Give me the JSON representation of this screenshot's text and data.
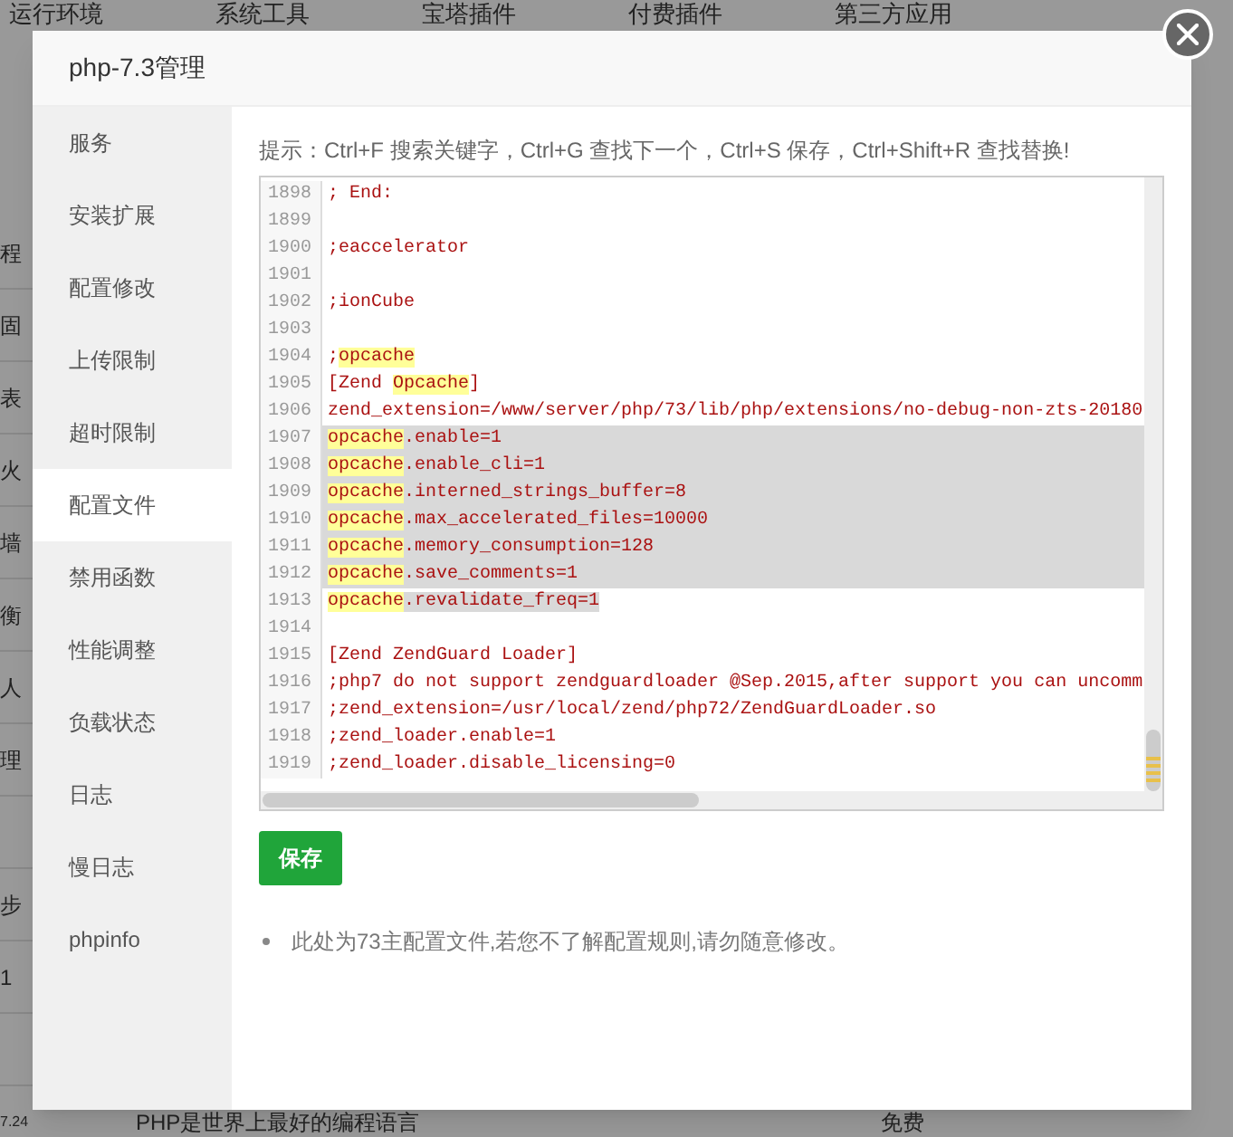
{
  "background": {
    "nav_tabs": [
      "运行环境",
      "系统工具",
      "宝塔插件",
      "付费插件",
      "第三方应用"
    ],
    "side_fragments": [
      {
        "text": "程"
      },
      {
        "text": "固"
      },
      {
        "text": "表"
      },
      {
        "text": "火"
      },
      {
        "text": "墙"
      },
      {
        "text": "衡"
      },
      {
        "text": "人"
      },
      {
        "text": "理"
      },
      {
        "text": "步",
        "blank_row_before": true
      },
      {
        "text": "1"
      },
      {
        "text": "7.24",
        "blank_row_before": true
      }
    ],
    "bottom_row": {
      "name": "PHP是世界上最好的编程语言",
      "price": "免费"
    }
  },
  "dialog": {
    "title": "php-7.3管理",
    "sidebar": [
      {
        "label": "服务",
        "selected": false
      },
      {
        "label": "安装扩展",
        "selected": false
      },
      {
        "label": "配置修改",
        "selected": false
      },
      {
        "label": "上传限制",
        "selected": false
      },
      {
        "label": "超时限制",
        "selected": false
      },
      {
        "label": "配置文件",
        "selected": true
      },
      {
        "label": "禁用函数",
        "selected": false
      },
      {
        "label": "性能调整",
        "selected": false
      },
      {
        "label": "负载状态",
        "selected": false
      },
      {
        "label": "日志",
        "selected": false
      },
      {
        "label": "慢日志",
        "selected": false
      },
      {
        "label": "phpinfo",
        "selected": false
      }
    ],
    "hint": "提示：Ctrl+F 搜索关键字，Ctrl+G 查找下一个，Ctrl+S 保存，Ctrl+Shift+R 查找替换!",
    "editor": {
      "lines": [
        {
          "number": "1898",
          "segments": [
            {
              "text": "; End:",
              "match": false
            }
          ],
          "selected": false
        },
        {
          "number": "1899",
          "selected": false
        },
        {
          "number": "1900",
          "segments": [
            {
              "text": ";eaccelerator",
              "match": false
            }
          ],
          "selected": false
        },
        {
          "number": "1901",
          "selected": false
        },
        {
          "number": "1902",
          "segments": [
            {
              "text": ";ionCube",
              "match": false
            }
          ],
          "selected": false
        },
        {
          "number": "1903",
          "selected": false
        },
        {
          "number": "1904",
          "segments": [
            {
              "text": ";",
              "match": false
            },
            {
              "text": "opcache",
              "match": true
            }
          ],
          "selected": false
        },
        {
          "number": "1905",
          "segments": [
            {
              "text": "[Zend ",
              "match": false
            },
            {
              "text": "Opcache",
              "match": true
            },
            {
              "text": "]",
              "match": false
            }
          ],
          "selected": false
        },
        {
          "number": "1906",
          "segments": [
            {
              "text": "zend_extension=/www/server/php/73/lib/php/extensions/no-debug-non-zts-20180",
              "match": false
            }
          ],
          "selected": false
        },
        {
          "number": "1907",
          "segments": [
            {
              "text": "opcache",
              "match": true
            },
            {
              "text": ".enable=1",
              "match": false
            }
          ],
          "selected": true
        },
        {
          "number": "1908",
          "segments": [
            {
              "text": "opcache",
              "match": true
            },
            {
              "text": ".enable_cli=1",
              "match": false
            }
          ],
          "selected": true
        },
        {
          "number": "1909",
          "segments": [
            {
              "text": "opcache",
              "match": true
            },
            {
              "text": ".interned_strings_buffer=8",
              "match": false
            }
          ],
          "selected": true
        },
        {
          "number": "1910",
          "segments": [
            {
              "text": "opcache",
              "match": true
            },
            {
              "text": ".max_accelerated_files=10000",
              "match": false
            }
          ],
          "selected": true
        },
        {
          "number": "1911",
          "segments": [
            {
              "text": "opcache",
              "match": true
            },
            {
              "text": ".memory_consumption=128",
              "match": false
            }
          ],
          "selected": true
        },
        {
          "number": "1912",
          "segments": [
            {
              "text": "opcache",
              "match": true
            },
            {
              "text": ".save_comments=1",
              "match": false
            }
          ],
          "selected": true
        },
        {
          "number": "1913",
          "segments": [
            {
              "text": "opcache",
              "match": true
            },
            {
              "text": ".revalidate_freq=1",
              "match": false
            }
          ],
          "selected": true
        },
        {
          "number": "1914",
          "selected": false
        },
        {
          "number": "1915",
          "segments": [
            {
              "text": "[Zend ZendGuard Loader]",
              "match": false
            }
          ],
          "selected": false
        },
        {
          "number": "1916",
          "segments": [
            {
              "text": ";php7 do not support zendguardloader @Sep.2015,after support you can uncomm",
              "match": false
            }
          ],
          "selected": false
        },
        {
          "number": "1917",
          "segments": [
            {
              "text": ";zend_extension=/usr/local/zend/php72/ZendGuardLoader.so",
              "match": false
            }
          ],
          "selected": false
        },
        {
          "number": "1918",
          "segments": [
            {
              "text": ";zend_loader.enable=1",
              "match": false
            }
          ],
          "selected": false
        },
        {
          "number": "1919",
          "segments": [
            {
              "text": ";zend_loader.disable_licensing=0",
              "match": false
            }
          ],
          "selected": false
        }
      ]
    },
    "save_button": "保存",
    "note": "此处为73主配置文件,若您不了解配置规则,请勿随意修改。"
  }
}
